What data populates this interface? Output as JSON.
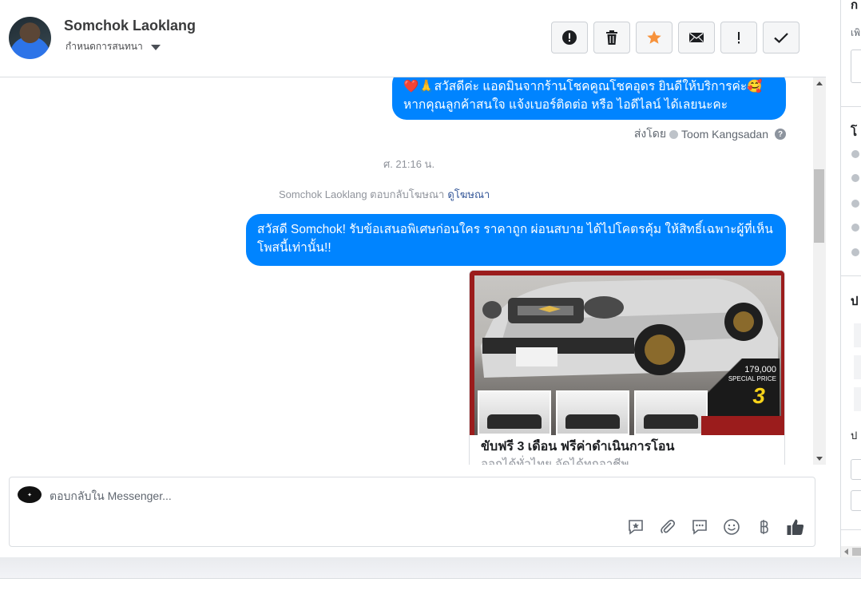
{
  "header": {
    "contact_name": "Somchok Laoklang",
    "assign_label": "กำหนดการสนทนา",
    "toolbar": [
      {
        "icon": "alert-circle-icon",
        "action": "mark-spam"
      },
      {
        "icon": "trash-icon",
        "action": "delete"
      },
      {
        "icon": "star-icon",
        "action": "star",
        "color": "#f7923b"
      },
      {
        "icon": "envelope-icon",
        "action": "mark-unread"
      },
      {
        "icon": "exclamation-icon",
        "action": "follow-up"
      },
      {
        "icon": "checkmark-icon",
        "action": "mark-done"
      }
    ]
  },
  "messages": {
    "bubble_1": "❤️🙏สวัสดีค่ะ แอดมินจากร้านโชคคูณโชคอุดร ยินดีให้บริการค่ะ🥰 หากคุณลูกค้าสนใจ แจ้งเบอร์ติดต่อ หรือ ไอดีไลน์ ได้เลยนะคะ",
    "sent_by_label": "ส่งโดย",
    "sent_by_name": "Toom Kangsadan",
    "timestamp": "ศ. 21:16 น.",
    "ad_reply_note": "Somchok Laoklang ตอบกลับโฆษณา",
    "ad_reply_link": "ดูโฆษณา",
    "bubble_2": "สวัสดี Somchok! รับข้อเสนอพิเศษก่อนใคร ราคาถูก ผ่อนสบาย ได้ไปโคตรคุ้ม ให้สิทธิ์เฉพาะผู้ที่เห็นโพสนี้เท่านั้น!!",
    "ad_card": {
      "price": "179,000",
      "special": "SPECIAL PRICE",
      "promo_number": "3",
      "title": "ขับฟรี 3 เดือน ฟรีค่าดำเนินการโอน",
      "subtitle": "ออกได้ทั่วไทย จัดได้ทุกอาชีพ"
    }
  },
  "composer": {
    "placeholder": "ตอบกลับใน Messenger...",
    "actions": [
      "saved-reply-icon",
      "attachment-icon",
      "chat-bubble-icon",
      "emoji-icon",
      "baht-icon",
      "thumbs-up-icon"
    ]
  },
  "side_panel": {
    "h1": "ก",
    "s1": "เพิ",
    "h2": "โ",
    "h3": "ป",
    "s2": "ป"
  },
  "colors": {
    "bubble": "#0084ff",
    "link": "#365899",
    "star": "#f7923b"
  }
}
